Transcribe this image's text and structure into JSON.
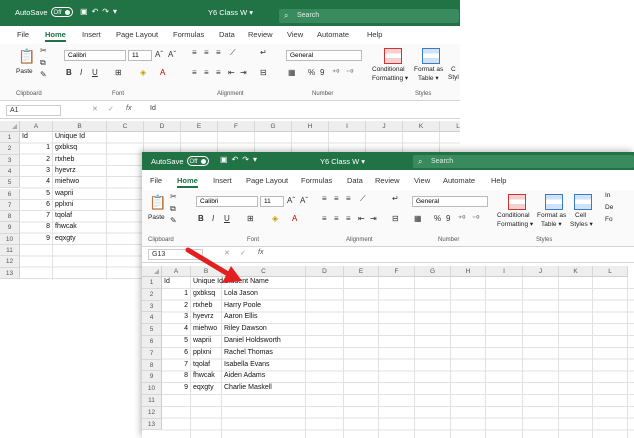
{
  "back": {
    "autosave_label": "AutoSave",
    "autosave_state": "Off",
    "doc_title": "Y6 Class W",
    "search_placeholder": "Search",
    "menu": [
      "File",
      "Home",
      "Insert",
      "Page Layout",
      "Formulas",
      "Data",
      "Review",
      "View",
      "Automate",
      "Help"
    ],
    "active_menu": "Home",
    "ribbon": {
      "paste": "Paste",
      "font_name": "Calibri",
      "font_size": "11",
      "number_format": "General",
      "conditional": "Conditional",
      "formatting": "Formatting",
      "format_as": "Format as",
      "table": "Table",
      "cell_partial": "C",
      "style_partial": "Styl",
      "groups": {
        "clipboard": "Clipboard",
        "font": "Font",
        "alignment": "Alignment",
        "number": "Number",
        "styles": "Styles"
      }
    },
    "name_box": "A1",
    "formula": "Id",
    "columns": [
      "A",
      "B",
      "C",
      "D",
      "E",
      "F",
      "G",
      "H",
      "I",
      "J",
      "K",
      "L"
    ],
    "rows": [
      "1",
      "2",
      "3",
      "4",
      "5",
      "6",
      "7",
      "8",
      "9",
      "10",
      "11",
      "12",
      "13"
    ],
    "headers": [
      "Id",
      "Unique Id"
    ],
    "data": [
      [
        "1",
        "gxbksq"
      ],
      [
        "2",
        "rtxheb"
      ],
      [
        "3",
        "hyevrz"
      ],
      [
        "4",
        "miehwo"
      ],
      [
        "5",
        "waprii"
      ],
      [
        "6",
        "pplxni"
      ],
      [
        "7",
        "tqolaf"
      ],
      [
        "8",
        "fhwcak"
      ],
      [
        "9",
        "eqxgty"
      ]
    ]
  },
  "front": {
    "autosave_label": "AutoSave",
    "autosave_state": "Off",
    "doc_title": "Y6 Class W",
    "search_placeholder": "Search",
    "menu": [
      "File",
      "Home",
      "Insert",
      "Page Layout",
      "Formulas",
      "Data",
      "Review",
      "View",
      "Automate",
      "Help"
    ],
    "active_menu": "Home",
    "ribbon": {
      "paste": "Paste",
      "font_name": "Calibri",
      "font_size": "11",
      "number_format": "General",
      "conditional": "Conditional",
      "formatting": "Formatting",
      "format_as": "Format as",
      "table": "Table",
      "cell": "Cell",
      "styles_btn": "Styles",
      "ins": "In",
      "del": "De",
      "fmt": "Fo",
      "groups": {
        "clipboard": "Clipboard",
        "font": "Font",
        "alignment": "Alignment",
        "number": "Number",
        "styles": "Styles"
      }
    },
    "name_box": "G13",
    "formula": "",
    "columns": [
      "A",
      "B",
      "C",
      "D",
      "E",
      "F",
      "G",
      "H",
      "I",
      "J",
      "K",
      "L"
    ],
    "rows": [
      "1",
      "2",
      "3",
      "4",
      "5",
      "6",
      "7",
      "8",
      "9",
      "10",
      "11",
      "12",
      "13"
    ],
    "headers": [
      "Id",
      "Unique Id",
      "Student Name"
    ],
    "data": [
      [
        "1",
        "gxbksq",
        "Lola Jason"
      ],
      [
        "2",
        "rtxheb",
        "Harry Poole"
      ],
      [
        "3",
        "hyevrz",
        "Aaron Ellis"
      ],
      [
        "4",
        "miehwo",
        "Riley Dawson"
      ],
      [
        "5",
        "waprii",
        "Daniel Holdsworth"
      ],
      [
        "6",
        "pplxni",
        "Rachel Thomas"
      ],
      [
        "7",
        "tqolaf",
        "Isabella Evans"
      ],
      [
        "8",
        "fhwcak",
        "Aiden Adams"
      ],
      [
        "9",
        "eqxgty",
        "Charlie Maskell"
      ]
    ]
  },
  "colors": {
    "excel_green": "#217346",
    "arrow_red": "#e32020"
  }
}
